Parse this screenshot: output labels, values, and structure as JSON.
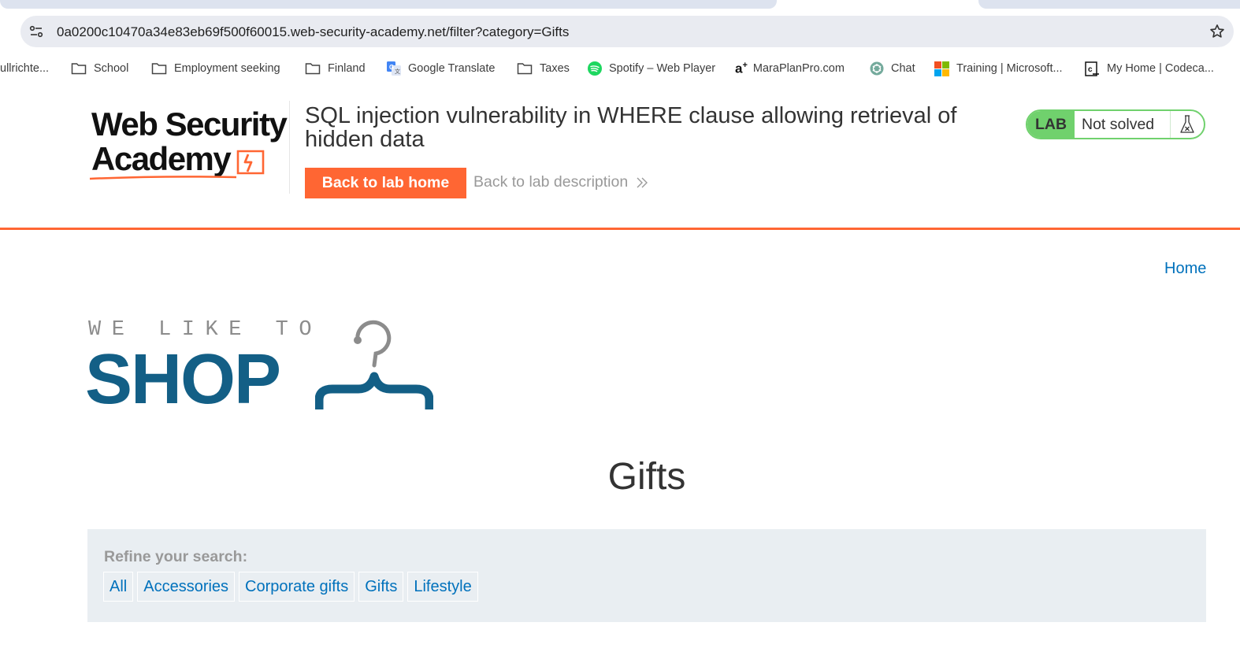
{
  "browser": {
    "url": "0a0200c10470a34e83eb69f500f60015.web-security-academy.net/filter?category=Gifts",
    "bookmarks": [
      {
        "label": "ullrichte...",
        "icon": "none"
      },
      {
        "label": "School",
        "icon": "folder-icon"
      },
      {
        "label": "Employment seeking",
        "icon": "folder-icon"
      },
      {
        "label": "Finland",
        "icon": "folder-icon"
      },
      {
        "label": "Google Translate",
        "icon": "google-translate-icon"
      },
      {
        "label": "Taxes",
        "icon": "folder-icon"
      },
      {
        "label": "Spotify – Web Player",
        "icon": "spotify-icon"
      },
      {
        "label": "MaraPlanPro.com",
        "icon": "aplus-icon"
      },
      {
        "label": "Chat",
        "icon": "chatgpt-icon"
      },
      {
        "label": "Training | Microsoft...",
        "icon": "microsoft-icon"
      },
      {
        "label": "My Home | Codeca...",
        "icon": "codecademy-icon"
      }
    ]
  },
  "lab_header": {
    "logo_line1": "Web Security",
    "logo_line2": "Academy",
    "title": "SQL injection vulnerability in WHERE clause allowing retrieval of hidden data",
    "back_home_label": "Back to lab home",
    "back_description_label": "Back to lab description",
    "status_badge": "LAB",
    "status_text": "Not solved",
    "accent_color": "#ff6633",
    "solved_color": "#70d16d"
  },
  "shop": {
    "nav_home": "Home",
    "logo_tagline": "WE LIKE TO",
    "logo_word": "SHOP",
    "page_title": "Gifts",
    "refine_label": "Refine your search:",
    "categories": [
      "All",
      "Accessories",
      "Corporate gifts",
      "Gifts",
      "Lifestyle"
    ],
    "brand_color": "#135f86",
    "link_color": "#0071bc"
  }
}
